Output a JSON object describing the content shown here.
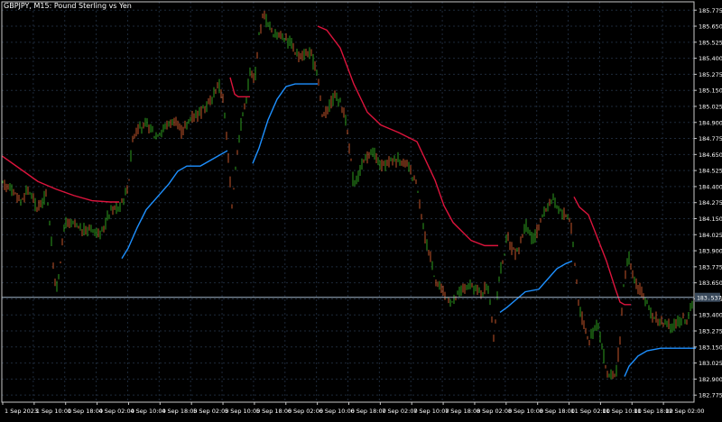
{
  "window": {
    "symbol_title": "GBPJPY, M15:  Pound Sterling vs Yen"
  },
  "colors": {
    "background": "#000000",
    "grid": "#1e2a3a",
    "axis": "#c8c8c8",
    "text": "#ffffff",
    "bull_candle": "#2e9d1e",
    "bear_candle": "#c2552a",
    "upper_band": "#dc143c",
    "lower_band": "#1e90ff",
    "price_line": "#a0b4c8",
    "price_label_bg": "#3a4a5c"
  },
  "current_price_label": "183.537",
  "chart_data": {
    "type": "candlestick",
    "title": "GBPJPY, M15:  Pound Sterling vs Yen",
    "y_ticks": [
      "185.775",
      "185.650",
      "185.525",
      "185.400",
      "185.275",
      "185.150",
      "185.025",
      "184.900",
      "184.775",
      "184.650",
      "184.525",
      "184.400",
      "184.275",
      "184.150",
      "184.025",
      "183.900",
      "183.775",
      "183.650",
      "183.525",
      "183.400",
      "183.275",
      "183.150",
      "183.025",
      "182.900",
      "182.775"
    ],
    "x_ticks": [
      "1 Sep 2023",
      "1 Sep 10:00",
      "1 Sep 18:00",
      "4 Sep 02:00",
      "4 Sep 10:00",
      "4 Sep 18:00",
      "5 Sep 02:00",
      "5 Sep 10:00",
      "5 Sep 18:00",
      "6 Sep 02:00",
      "6 Sep 10:00",
      "6 Sep 18:00",
      "7 Sep 02:00",
      "7 Sep 10:00",
      "7 Sep 18:00",
      "8 Sep 02:00",
      "8 Sep 10:00",
      "8 Sep 18:00",
      "11 Sep 02:00",
      "11 Sep 10:00",
      "11 Sep 18:00",
      "12 Sep 02:00"
    ],
    "ylim": [
      182.72,
      185.84
    ],
    "current_price": 183.537,
    "close_path": [
      [
        0,
        184.42
      ],
      [
        10,
        184.4
      ],
      [
        20,
        184.28
      ],
      [
        30,
        184.38
      ],
      [
        40,
        184.22
      ],
      [
        50,
        184.36
      ],
      [
        60,
        183.56
      ],
      [
        70,
        184.12
      ],
      [
        80,
        184.1
      ],
      [
        90,
        184.05
      ],
      [
        100,
        184.08
      ],
      [
        110,
        184.02
      ],
      [
        120,
        184.22
      ],
      [
        130,
        184.24
      ],
      [
        140,
        184.4
      ],
      [
        145,
        184.78
      ],
      [
        150,
        184.85
      ],
      [
        160,
        184.88
      ],
      [
        170,
        184.8
      ],
      [
        180,
        184.86
      ],
      [
        190,
        184.92
      ],
      [
        200,
        184.82
      ],
      [
        210,
        184.95
      ],
      [
        220,
        184.98
      ],
      [
        230,
        185.05
      ],
      [
        240,
        185.2
      ],
      [
        245,
        185.1
      ],
      [
        250,
        184.7
      ],
      [
        255,
        184.26
      ],
      [
        260,
        184.62
      ],
      [
        265,
        184.9
      ],
      [
        270,
        185.05
      ],
      [
        275,
        185.3
      ],
      [
        280,
        185.22
      ],
      [
        285,
        185.58
      ],
      [
        290,
        185.75
      ],
      [
        300,
        185.6
      ],
      [
        310,
        185.58
      ],
      [
        320,
        185.52
      ],
      [
        330,
        185.4
      ],
      [
        340,
        185.45
      ],
      [
        350,
        185.3
      ],
      [
        355,
        184.95
      ],
      [
        360,
        185.0
      ],
      [
        370,
        185.12
      ],
      [
        380,
        184.98
      ],
      [
        385,
        184.7
      ],
      [
        390,
        184.4
      ],
      [
        395,
        184.5
      ],
      [
        400,
        184.58
      ],
      [
        410,
        184.68
      ],
      [
        420,
        184.55
      ],
      [
        430,
        184.6
      ],
      [
        440,
        184.62
      ],
      [
        450,
        184.55
      ],
      [
        460,
        184.4
      ],
      [
        465,
        184.15
      ],
      [
        470,
        183.98
      ],
      [
        480,
        183.7
      ],
      [
        490,
        183.55
      ],
      [
        500,
        183.5
      ],
      [
        510,
        183.6
      ],
      [
        520,
        183.62
      ],
      [
        530,
        183.58
      ],
      [
        540,
        183.62
      ],
      [
        545,
        183.18
      ],
      [
        550,
        183.65
      ],
      [
        560,
        184.0
      ],
      [
        570,
        183.85
      ],
      [
        580,
        184.1
      ],
      [
        590,
        183.98
      ],
      [
        600,
        184.2
      ],
      [
        610,
        184.3
      ],
      [
        620,
        184.2
      ],
      [
        630,
        184.15
      ],
      [
        640,
        183.45
      ],
      [
        650,
        183.2
      ],
      [
        660,
        183.35
      ],
      [
        670,
        182.95
      ],
      [
        680,
        182.9
      ],
      [
        685,
        183.2
      ],
      [
        690,
        183.7
      ],
      [
        695,
        183.85
      ],
      [
        700,
        183.68
      ],
      [
        710,
        183.55
      ],
      [
        720,
        183.4
      ],
      [
        730,
        183.35
      ],
      [
        740,
        183.3
      ],
      [
        750,
        183.35
      ],
      [
        760,
        183.38
      ],
      [
        770,
        183.55
      ]
    ],
    "upper_band": [
      [
        [
          0,
          184.64
        ],
        [
          20,
          184.54
        ],
        [
          40,
          184.44
        ],
        [
          60,
          184.38
        ],
        [
          80,
          184.33
        ],
        [
          100,
          184.29
        ],
        [
          120,
          184.28
        ],
        [
          130,
          184.28
        ]
      ],
      [
        [
          253,
          185.25
        ],
        [
          258,
          185.12
        ],
        [
          262,
          185.1
        ],
        [
          275,
          185.1
        ]
      ],
      [
        [
          350,
          185.65
        ],
        [
          360,
          185.62
        ],
        [
          375,
          185.48
        ],
        [
          390,
          185.2
        ],
        [
          405,
          184.98
        ],
        [
          420,
          184.88
        ],
        [
          440,
          184.82
        ],
        [
          460,
          184.75
        ],
        [
          470,
          184.6
        ],
        [
          480,
          184.45
        ],
        [
          490,
          184.25
        ],
        [
          500,
          184.12
        ],
        [
          510,
          184.05
        ],
        [
          520,
          183.98
        ],
        [
          535,
          183.94
        ],
        [
          550,
          183.94
        ]
      ],
      [
        [
          634,
          184.32
        ],
        [
          640,
          184.24
        ],
        [
          650,
          184.18
        ],
        [
          660,
          184.0
        ],
        [
          670,
          183.82
        ],
        [
          680,
          183.6
        ],
        [
          685,
          183.5
        ],
        [
          690,
          183.48
        ],
        [
          697,
          183.48
        ]
      ]
    ],
    "lower_band": [
      [
        [
          133,
          183.84
        ],
        [
          140,
          183.92
        ],
        [
          150,
          184.08
        ],
        [
          160,
          184.22
        ],
        [
          175,
          184.34
        ],
        [
          185,
          184.42
        ],
        [
          195,
          184.52
        ],
        [
          205,
          184.56
        ],
        [
          220,
          184.56
        ],
        [
          235,
          184.62
        ],
        [
          250,
          184.68
        ]
      ],
      [
        [
          278,
          184.58
        ],
        [
          285,
          184.7
        ],
        [
          295,
          184.92
        ],
        [
          305,
          185.08
        ],
        [
          315,
          185.18
        ],
        [
          325,
          185.2
        ],
        [
          350,
          185.2
        ]
      ],
      [
        [
          552,
          183.42
        ],
        [
          560,
          183.46
        ],
        [
          570,
          183.52
        ],
        [
          580,
          183.58
        ],
        [
          595,
          183.6
        ],
        [
          605,
          183.68
        ],
        [
          615,
          183.76
        ],
        [
          625,
          183.8
        ],
        [
          632,
          183.82
        ]
      ],
      [
        [
          690,
          182.92
        ],
        [
          695,
          183.0
        ],
        [
          705,
          183.08
        ],
        [
          715,
          183.12
        ],
        [
          730,
          183.14
        ],
        [
          769,
          183.14
        ]
      ]
    ]
  }
}
